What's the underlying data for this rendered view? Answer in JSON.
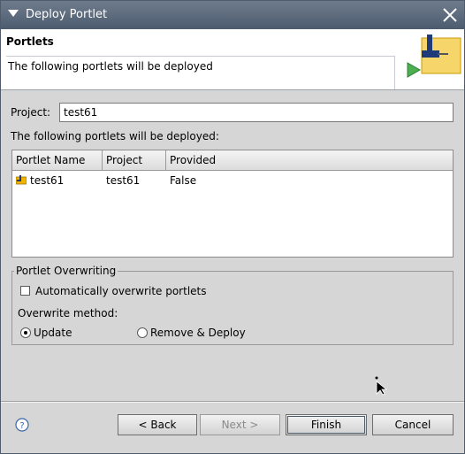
{
  "window": {
    "title": "Deploy Portlet"
  },
  "banner": {
    "title": "Portlets",
    "message": "The following portlets will be deployed"
  },
  "project": {
    "label": "Project:",
    "value": "test61"
  },
  "list_label": "The following portlets will be deployed:",
  "table": {
    "columns": [
      "Portlet Name",
      "Project",
      "Provided"
    ],
    "rows": [
      {
        "name": "test61",
        "project": "test61",
        "provided": "False"
      }
    ]
  },
  "overwrite": {
    "legend": "Portlet Overwriting",
    "auto_label": "Automatically overwrite portlets",
    "auto_checked": false,
    "method_label": "Overwrite method:",
    "options": [
      "Update",
      "Remove & Deploy"
    ],
    "selected": "Update"
  },
  "buttons": {
    "back": "< Back",
    "next": "Next >",
    "finish": "Finish",
    "cancel": "Cancel"
  },
  "icons": {
    "menu": "dropdown-triangle-icon",
    "close": "close-icon",
    "banner": "portlet-deploy-icon",
    "help": "help-icon",
    "row": "portlet-icon"
  },
  "colors": {
    "titlebar": "#5c6a7d",
    "dialog_bg": "#d6d6d6",
    "icon_accent": "#f0b400"
  }
}
